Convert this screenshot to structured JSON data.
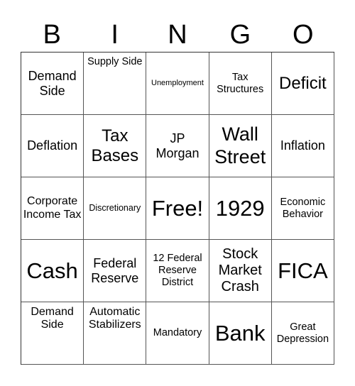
{
  "header": {
    "letters": [
      "B",
      "I",
      "N",
      "G",
      "O"
    ]
  },
  "cells": [
    {
      "text": "Demand Side"
    },
    {
      "text": "Supply Side"
    },
    {
      "text": "Unemployment"
    },
    {
      "text": "Tax Structures"
    },
    {
      "text": "Deficit"
    },
    {
      "text": "Deflation"
    },
    {
      "text": "Tax Bases"
    },
    {
      "text": "JP Morgan"
    },
    {
      "text": "Wall Street"
    },
    {
      "text": "Inflation"
    },
    {
      "text": "Corporate Income Tax"
    },
    {
      "text": "Discretionary"
    },
    {
      "text": "Free!"
    },
    {
      "text": "1929"
    },
    {
      "text": "Economic Behavior"
    },
    {
      "text": "Cash"
    },
    {
      "text": "Federal Reserve"
    },
    {
      "text": "12 Federal Reserve District"
    },
    {
      "text": "Stock Market Crash"
    },
    {
      "text": "FICA"
    },
    {
      "text": "Demand Side"
    },
    {
      "text": "Automatic Stabilizers"
    },
    {
      "text": "Mandatory"
    },
    {
      "text": "Bank"
    },
    {
      "text": "Great Depression"
    }
  ]
}
